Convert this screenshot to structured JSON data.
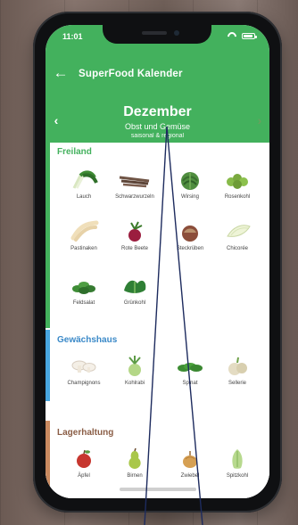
{
  "status_bar": {
    "time": "11:01",
    "wifi_icon": "wifi-icon",
    "battery_icon": "battery-icon"
  },
  "header": {
    "back_icon": "arrow-left-icon",
    "title": "SuperFood Kalender",
    "month": "Dezember",
    "subtitle": "Obst und Gemüse",
    "note": "saisonal & regional",
    "prev_icon": "chevron-left-icon",
    "next_icon": "chevron-right-icon"
  },
  "colors": {
    "header_green": "#43b15d",
    "section_blue": "#47a5df",
    "section_brown": "#c9895f",
    "wood_background": "#7e6c66"
  },
  "sections": [
    {
      "title": "Freiland",
      "items": [
        {
          "label": "Lauch",
          "icon": "leek-icon"
        },
        {
          "label": "Schwarzwurzeln",
          "icon": "salsify-icon"
        },
        {
          "label": "Wirsing",
          "icon": "savoy-cabbage-icon"
        },
        {
          "label": "Rosenkohl",
          "icon": "brussels-sprouts-icon"
        },
        {
          "label": "Pastinaken",
          "icon": "parsnip-icon"
        },
        {
          "label": "Rote Beete",
          "icon": "beetroot-icon"
        },
        {
          "label": "Steckrüben",
          "icon": "swede-icon"
        },
        {
          "label": "Chicorée",
          "icon": "chicory-icon"
        },
        {
          "label": "Feldsalat",
          "icon": "lambs-lettuce-icon"
        },
        {
          "label": "Grünkohl",
          "icon": "kale-icon"
        }
      ]
    },
    {
      "title": "Gewächshaus",
      "items": [
        {
          "label": "Champignons",
          "icon": "mushroom-icon"
        },
        {
          "label": "Kohlrabi",
          "icon": "kohlrabi-icon"
        },
        {
          "label": "Spinat",
          "icon": "spinach-icon"
        },
        {
          "label": "Sellerie",
          "icon": "celeriac-icon"
        }
      ]
    },
    {
      "title": "Lagerhaltung",
      "items": [
        {
          "label": "Äpfel",
          "icon": "apple-icon"
        },
        {
          "label": "Birnen",
          "icon": "pear-icon"
        },
        {
          "label": "Zwiebel",
          "icon": "onion-icon"
        },
        {
          "label": "Spitzkohl",
          "icon": "pointed-cabbage-icon"
        }
      ]
    }
  ]
}
